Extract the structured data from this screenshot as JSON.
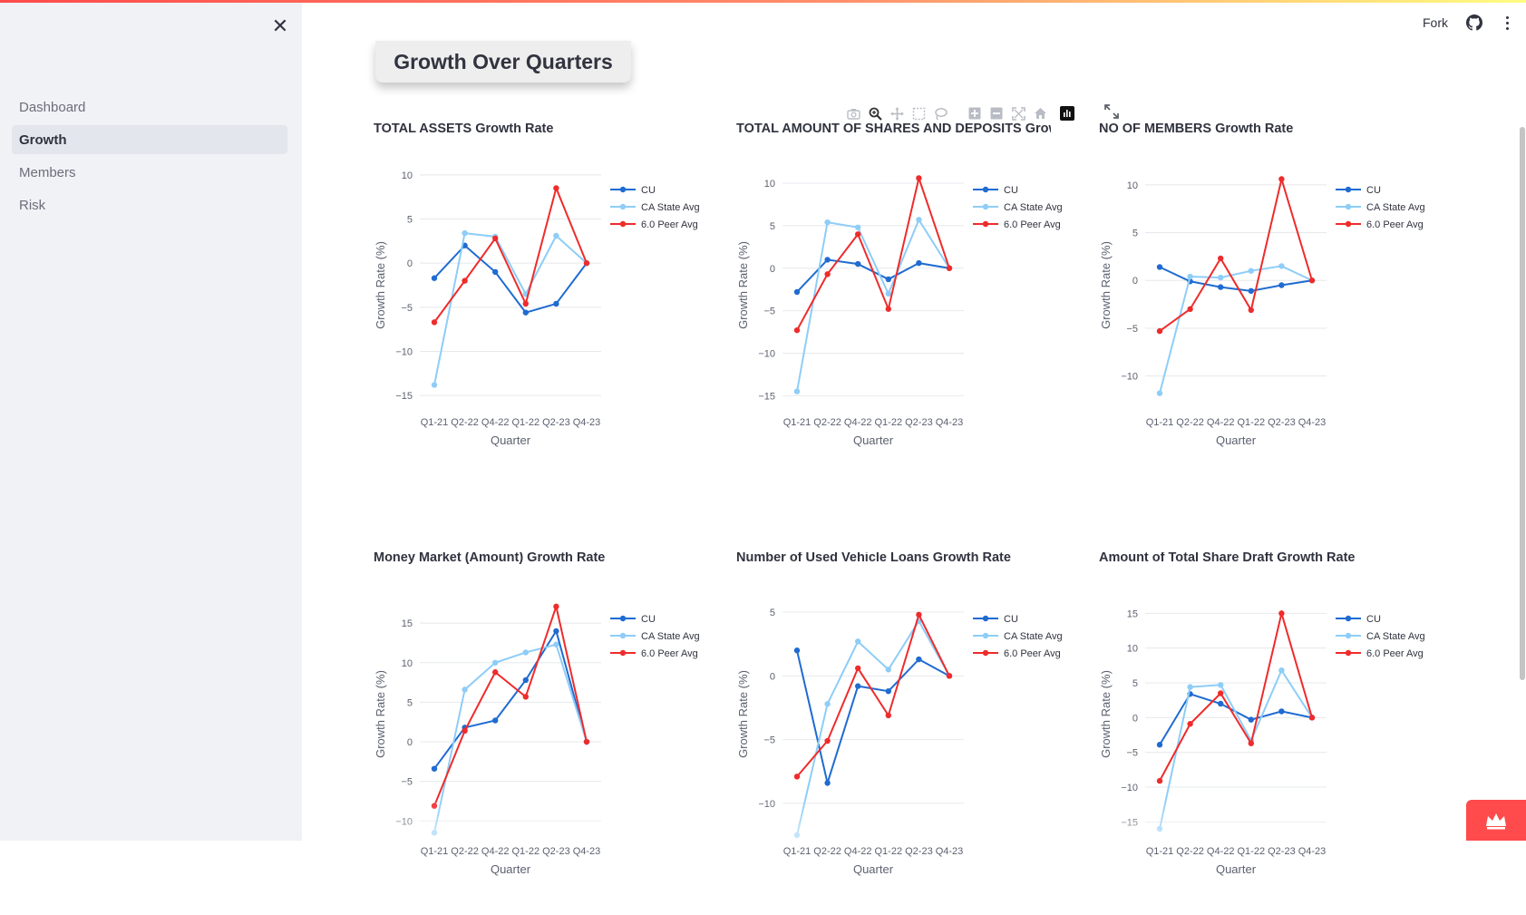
{
  "sidebar": {
    "items": [
      {
        "label": "Dashboard",
        "active": false
      },
      {
        "label": "Growth",
        "active": true
      },
      {
        "label": "Members",
        "active": false
      },
      {
        "label": "Risk",
        "active": false
      }
    ]
  },
  "header": {
    "fork_label": "Fork"
  },
  "page": {
    "title": "Growth Over Quarters"
  },
  "colors": {
    "accent": "#ff4b4b",
    "cu": "#1f6bd1",
    "state": "#8ecdf8",
    "peer": "#ef2b2b"
  },
  "chart_data": [
    {
      "type": "line",
      "title": "TOTAL ASSETS Growth Rate",
      "xlabel": "Quarter",
      "ylabel": "Growth Rate (%)",
      "x": [
        "Q1-21",
        "Q2-22",
        "Q4-22",
        "Q1-22",
        "Q2-23",
        "Q4-23"
      ],
      "ylim": [
        -15.5,
        10.5
      ],
      "ticks": [
        10,
        5,
        0,
        -5,
        -10,
        -15
      ],
      "series": [
        {
          "name": "CU",
          "values": [
            -1.7,
            2.0,
            -1.0,
            -5.6,
            -4.6,
            0.0
          ]
        },
        {
          "name": "CA State Avg",
          "values": [
            -13.8,
            3.4,
            3.0,
            -3.5,
            3.1,
            0.0
          ]
        },
        {
          "name": "6.0 Peer Avg",
          "values": [
            -6.7,
            -2.0,
            2.8,
            -4.6,
            8.5,
            0.0
          ]
        }
      ],
      "legend": "top-right",
      "grid": true
    },
    {
      "type": "line",
      "title": "TOTAL AMOUNT OF SHARES AND DEPOSITS Growth Rate",
      "xlabel": "Quarter",
      "ylabel": "Growth Rate (%)",
      "x": [
        "Q1-21",
        "Q2-22",
        "Q4-22",
        "Q1-22",
        "Q2-23",
        "Q4-23"
      ],
      "ylim": [
        -15.5,
        11.5
      ],
      "ticks": [
        10,
        5,
        0,
        -5,
        -10,
        -15
      ],
      "series": [
        {
          "name": "CU",
          "values": [
            -2.8,
            1.0,
            0.5,
            -1.3,
            0.6,
            0.0
          ]
        },
        {
          "name": "CA State Avg",
          "values": [
            -14.5,
            5.4,
            4.8,
            -3.0,
            5.7,
            0.0
          ]
        },
        {
          "name": "6.0 Peer Avg",
          "values": [
            -7.3,
            -0.7,
            4.0,
            -4.8,
            10.6,
            0.0
          ]
        }
      ],
      "legend": "top-right",
      "grid": true
    },
    {
      "type": "line",
      "title": "NO OF MEMBERS Growth Rate",
      "xlabel": "Quarter",
      "ylabel": "Growth Rate (%)",
      "x": [
        "Q1-21",
        "Q2-22",
        "Q4-22",
        "Q1-22",
        "Q2-23",
        "Q4-23"
      ],
      "ylim": [
        -12.5,
        11.5
      ],
      "ticks": [
        10,
        5,
        0,
        -5,
        -10
      ],
      "series": [
        {
          "name": "CU",
          "values": [
            1.4,
            -0.1,
            -0.7,
            -1.1,
            -0.5,
            0.0
          ]
        },
        {
          "name": "CA State Avg",
          "values": [
            -11.8,
            0.4,
            0.3,
            1.0,
            1.5,
            0.0
          ]
        },
        {
          "name": "6.0 Peer Avg",
          "values": [
            -5.3,
            -3.0,
            2.3,
            -3.1,
            10.6,
            0.0
          ]
        }
      ],
      "legend": "top-right",
      "grid": true
    },
    {
      "type": "line",
      "title": "Money Market (Amount) Growth Rate",
      "xlabel": "Quarter",
      "ylabel": "Growth Rate (%)",
      "x": [
        "Q1-21",
        "Q2-22",
        "Q4-22",
        "Q1-22",
        "Q2-23",
        "Q4-23"
      ],
      "ylim": [
        -11,
        18
      ],
      "ticks": [
        15,
        10,
        5,
        0,
        -5,
        -10
      ],
      "series": [
        {
          "name": "CU",
          "values": [
            -3.4,
            1.8,
            2.7,
            7.8,
            14.0,
            0.0
          ]
        },
        {
          "name": "CA State Avg",
          "values": [
            -11.5,
            6.6,
            10.0,
            11.3,
            12.3,
            0.0
          ]
        },
        {
          "name": "6.0 Peer Avg",
          "values": [
            -8.1,
            1.4,
            8.8,
            5.7,
            17.1,
            0.0
          ]
        }
      ],
      "legend": "top-right",
      "grid": true
    },
    {
      "type": "line",
      "title": "Number of Used Vehicle Loans Growth Rate",
      "xlabel": "Quarter",
      "ylabel": "Growth Rate (%)",
      "x": [
        "Q1-21",
        "Q2-22",
        "Q4-22",
        "Q1-22",
        "Q2-23",
        "Q4-23"
      ],
      "ylim": [
        -12,
        6
      ],
      "ticks": [
        5,
        0,
        -5,
        -10
      ],
      "series": [
        {
          "name": "CU",
          "values": [
            2.0,
            -8.4,
            -0.8,
            -1.2,
            1.3,
            0.0
          ]
        },
        {
          "name": "CA State Avg",
          "values": [
            -12.5,
            -2.2,
            2.7,
            0.5,
            4.3,
            0.0
          ]
        },
        {
          "name": "6.0 Peer Avg",
          "values": [
            -7.9,
            -5.1,
            0.6,
            -3.1,
            4.8,
            0.0
          ]
        }
      ],
      "legend": "top-right",
      "grid": true
    },
    {
      "type": "line",
      "title": "Amount of Total Share Draft Growth Rate",
      "xlabel": "Quarter",
      "ylabel": "Growth Rate (%)",
      "x": [
        "Q1-21",
        "Q2-22",
        "Q4-22",
        "Q1-22",
        "Q2-23",
        "Q4-23"
      ],
      "ylim": [
        -16,
        17
      ],
      "ticks": [
        15,
        10,
        5,
        0,
        -5,
        -10,
        -15
      ],
      "series": [
        {
          "name": "CU",
          "values": [
            -3.9,
            3.4,
            2.0,
            -0.3,
            0.9,
            0.0
          ]
        },
        {
          "name": "CA State Avg",
          "values": [
            -16.0,
            4.4,
            4.7,
            -3.3,
            6.8,
            0.0
          ]
        },
        {
          "name": "6.0 Peer Avg",
          "values": [
            -9.1,
            -0.9,
            3.5,
            -3.7,
            15.0,
            0.0
          ]
        }
      ],
      "legend": "top-right",
      "grid": true
    }
  ]
}
